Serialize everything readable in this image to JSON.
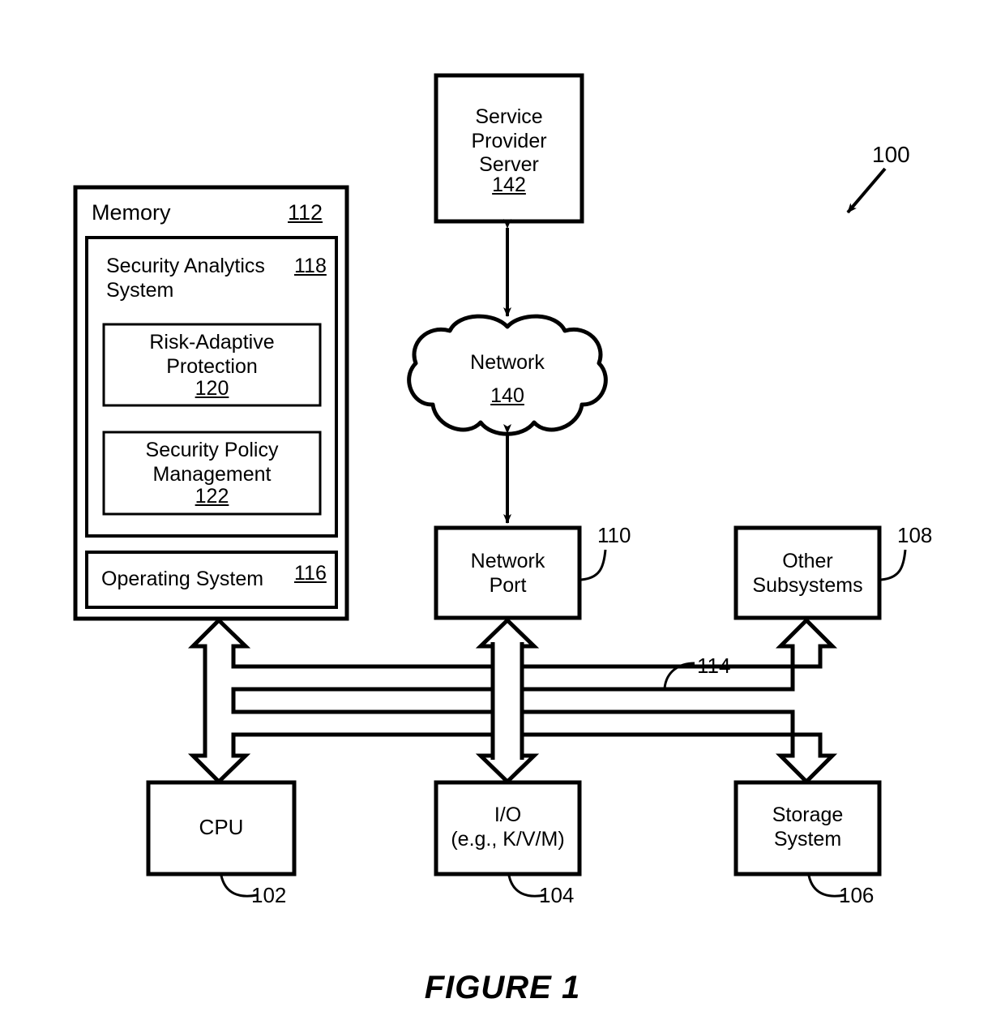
{
  "figure": {
    "caption": "FIGURE 1",
    "system_ref": "100"
  },
  "memory_block": {
    "title": "Memory",
    "ref": "112",
    "security_analytics": {
      "title": "Security Analytics\nSystem",
      "ref": "118",
      "modules": [
        {
          "title": "Risk-Adaptive\nProtection",
          "ref": "120"
        },
        {
          "title": "Security Policy\nManagement",
          "ref": "122"
        }
      ]
    },
    "operating_system": {
      "title": "Operating System",
      "ref": "116"
    }
  },
  "network_stack": {
    "service_provider_server": {
      "title": "Service\nProvider\nServer",
      "ref": "142"
    },
    "network_cloud": {
      "title": "Network",
      "ref": "140"
    },
    "network_port": {
      "title": "Network\nPort",
      "ref": "110"
    }
  },
  "subsystems": {
    "other_subsystems": {
      "title": "Other\nSubsystems",
      "ref": "108"
    }
  },
  "bus": {
    "ref": "114"
  },
  "bottom_row": [
    {
      "title": "CPU",
      "ref": "102"
    },
    {
      "title": "I/O\n(e.g., K/V/M)",
      "ref": "104"
    },
    {
      "title": "Storage\nSystem",
      "ref": "106"
    }
  ],
  "colors": {
    "stroke": "#000000",
    "fill": "#ffffff",
    "background": "#ffffff"
  }
}
